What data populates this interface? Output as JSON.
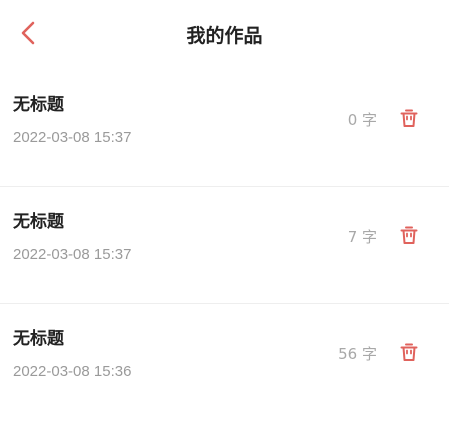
{
  "header": {
    "title": "我的作品",
    "back_icon": "chevron-left-icon"
  },
  "colors": {
    "accent": "#e0625c",
    "text_primary": "#222222",
    "text_secondary": "#9a9a9a",
    "divider": "#eeeeee"
  },
  "works": [
    {
      "title": "无标题",
      "date": "2022-03-08 15:37",
      "count": "0 字",
      "delete_icon": "trash-icon"
    },
    {
      "title": "无标题",
      "date": "2022-03-08 15:37",
      "count": "7 字",
      "delete_icon": "trash-icon"
    },
    {
      "title": "无标题",
      "date": "2022-03-08 15:36",
      "count": "56 字",
      "delete_icon": "trash-icon"
    }
  ]
}
